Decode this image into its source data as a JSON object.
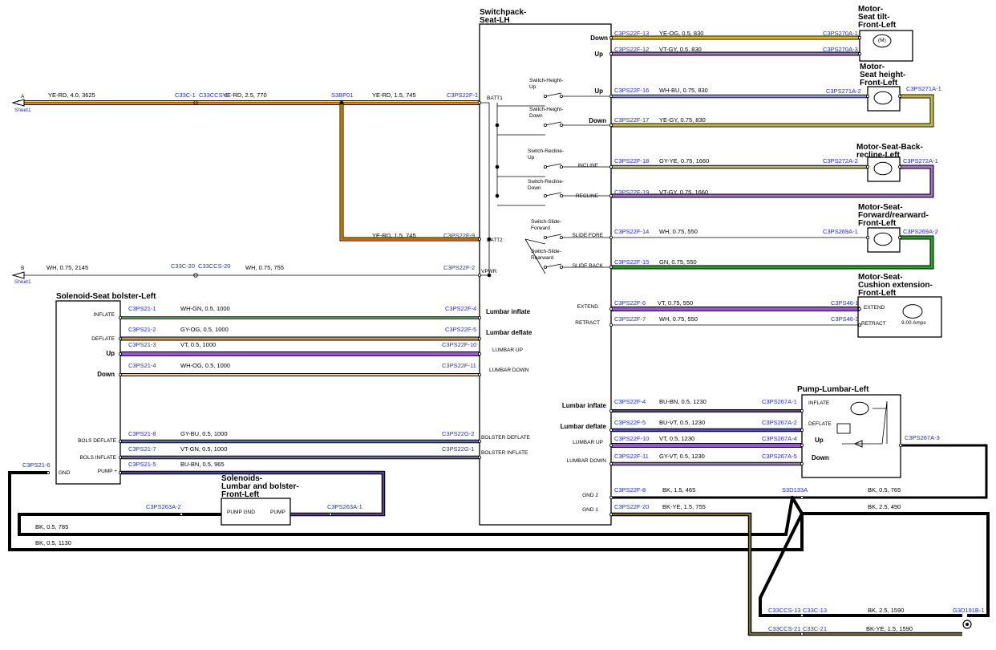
{
  "components": {
    "switchpack": "Switchpack-\nSeat-LH",
    "motor_tilt": "Motor-\nSeat tilt-\nFront-Left",
    "motor_height": "Motor-\nSeat height-\nFront-Left",
    "motor_recline": "Motor-Seat-Back-\nrecline-Left",
    "motor_fwd": "Motor-Seat-\nForward/rearward-\nFront-Left",
    "motor_cushion": "Motor-Seat-\nCushion extension-\nFront-Left",
    "solenoid_bolster": "Solenoid-Seat bolster-Left",
    "pump_lumbar": "Pump-Lumbar-Left",
    "solenoids_lumbar": "Solenoids-\nLumbar and bolster-\nFront-Left"
  },
  "switches": {
    "height_up": "Switch-Height-\nUp",
    "height_down": "Switch-Height-\nDown",
    "recline_up": "Switch-Recline-\nUp",
    "recline_down": "Switch-Recline-\nDown",
    "slide_fwd": "Switch-Slide-\nForward",
    "slide_rear": "Switch-Slide-\nRearward"
  },
  "pins": {
    "down": "Down",
    "up": "Up",
    "up2": "Up",
    "down2": "Down",
    "incline": "INCLINE",
    "recline": "RECLINE",
    "slide_fore": "SLIDE FORE",
    "slide_back": "SLIDE BACK",
    "batt1": "BATT1",
    "batt2": "BATT2",
    "vpwr": "VPWR",
    "lumbar_inflate": "Lumbar inflate",
    "lumbar_deflate": "Lumbar deflate",
    "lumbar_up": "LUMBAR UP",
    "lumbar_down": "LUMBAR DOWN",
    "extend": "EXTEND",
    "retract": "RETRACT",
    "bolster_deflate": "BOLSTER DEFLATE",
    "bolster_inflate": "BOLSTER INFLATE",
    "lumbar_inflate2": "Lumbar inflate",
    "lumbar_deflate2": "Lumbar deflate",
    "lumbar_up2": "LUMBAR UP",
    "lumbar_down2": "LUMBAR DOWN",
    "gnd2": "GND 2",
    "gnd1": "GND 1",
    "sol_inflate": "INFLATE",
    "sol_deflate": "DEFLATE",
    "sol_up": "Up",
    "sol_down": "Down",
    "sol_bols_deflate": "BOLS DEFLATE",
    "sol_bols_inflate": "BOLS INFLATE",
    "sol_pump": "PUMP +",
    "sol_gnd": "GND",
    "pump_inflate": "INFLATE",
    "pump_deflate": "DEFLATE",
    "pump_up": "Up",
    "pump_down": "Down",
    "cush_extend": "EXTEND",
    "cush_retract": "RETRACT",
    "cush_amps": "9.00 Amps",
    "sl_pumpgnd": "PUMP GND",
    "sl_pump": "PUMP",
    "tilt_m": "(M)"
  },
  "connectors": {
    "c1": "C33C-1",
    "c2": "C33CCS-1",
    "s3": "S3BP01",
    "c4": "C3PS22F-1",
    "c5": "C3PS22F-9",
    "c6": "C33C-20",
    "c7": "C33CCS-20",
    "c8": "C3PS22F-2",
    "c9": "C3PS22F-13",
    "c10": "C3PS270A-1",
    "c11": "C3PS22F-12",
    "c12": "C3PS270A-3",
    "c13": "C3PS22F-16",
    "c14": "C3PS271A-2",
    "c15": "C3PS271A-1",
    "c16": "C3PS22F-17",
    "c17": "C3PS22F-18",
    "c18": "C3PS272A-2",
    "c19": "C3PS272A-1",
    "c20": "C3PS22F-19",
    "c21": "C3PS22F-14",
    "c22": "C3PS269A-1",
    "c23": "C3PS269A-2",
    "c24": "C3PS22F-15",
    "c25": "C3PS22F-6",
    "c26": "C3PS46-1",
    "c27": "C3PS22F-7",
    "c28": "C3PS46-3",
    "c29": "C3PS21-1",
    "c30": "C3PS22F-4",
    "c31": "C3PS21-2",
    "c32": "C3PS22F-5",
    "c33": "C3PS21-3",
    "c34": "C3PS22F-10",
    "c35": "C3PS21-4",
    "c36": "C3PS22F-11",
    "c37": "C3PS21-8",
    "c38": "C3PS22G-2",
    "c39": "C3PS21-7",
    "c40": "C3PS22G-1",
    "c41": "C3PS21-5",
    "c42": "C3PS21-6",
    "c43": "C3PS263A-2",
    "c44": "C3PS263A-1",
    "c45": "C3PS22F-4",
    "c46": "C3PS267A-1",
    "c47": "C3PS22F-5",
    "c48": "C3PS267A-2",
    "c49": "C3PS22F-10",
    "c50": "C3PS267A-4",
    "c51": "C3PS22F-11",
    "c52": "C3PS267A-5",
    "c53": "C3PS267A-3",
    "c54": "C3PS22F-8",
    "c55": "S3D133A",
    "c56": "C3PS22F-20",
    "c57": "C33CCS-13",
    "c58": "C33C-13",
    "c59": "C33CCS-21",
    "c60": "C33C-21",
    "c61": "G3D191B-1"
  },
  "wires": {
    "w1": "YE-RD, 4.0, 3625",
    "w2": "YE-RD, 2.5, 770",
    "w3": "YE-RD, 1.5, 745",
    "w4": "YE-RD, 1.5, 745",
    "w5": "WH, 0.75, 2145",
    "w6": "WH, 0.75, 755",
    "w7": "YE-OG, 0.5, 830",
    "w8": "VT-GY, 0.5, 830",
    "w9": "WH-BU, 0.75, 830",
    "w10": "YE-GY, 0.75, 830",
    "w11": "GY-YE, 0.75, 1660",
    "w12": "VT-GY, 0.75, 1660",
    "w13": "WH, 0.75, 550",
    "w14": "GN, 0.75, 550",
    "w15": "VT, 0.75, 550",
    "w16": "WH, 0.75, 550",
    "w17": "WH-GN, 0.5, 1000",
    "w18": "GY-OG, 0.5, 1000",
    "w19": "VT, 0.5, 1000",
    "w20": "WH-OG, 0.5, 1000",
    "w21": "GY-BU, 0.5, 1000",
    "w22": "VT-GN, 0.5, 1000",
    "w23": "BU-BN, 0.5, 965",
    "w24": "BU-BN, 0.5, 1230",
    "w25": "BU-VT, 0.5, 1230",
    "w26": "VT, 0.5, 1230",
    "w27": "GY-VT, 0.5, 1230",
    "w28": "BK, 1.5, 465",
    "w29": "BK, 0.5, 765",
    "w30": "BK-YE, 1.5, 755",
    "w31": "BK, 2.5, 490",
    "w32": "BK, 0.5, 785",
    "w33": "BK, 0.5, 1130",
    "w34": "BK, 2.5, 1590",
    "w35": "BK-YE, 1.5, 1590"
  },
  "sheets": {
    "a_letter": "A",
    "a_sheet": "Sheet1",
    "b_letter": "B",
    "b_sheet": "Sheet1"
  },
  "colors": {
    "YE": "#f2e500",
    "RD": "#e00000",
    "OG": "#f5a000",
    "VT": "#a050e0",
    "GY": "#9a9a9a",
    "WH": "#ffffff",
    "BU": "#1f2fd1",
    "GN": "#1fa81f",
    "BN": "#a0522d",
    "BK": "#000000",
    "connector": "#1f2fd1"
  }
}
